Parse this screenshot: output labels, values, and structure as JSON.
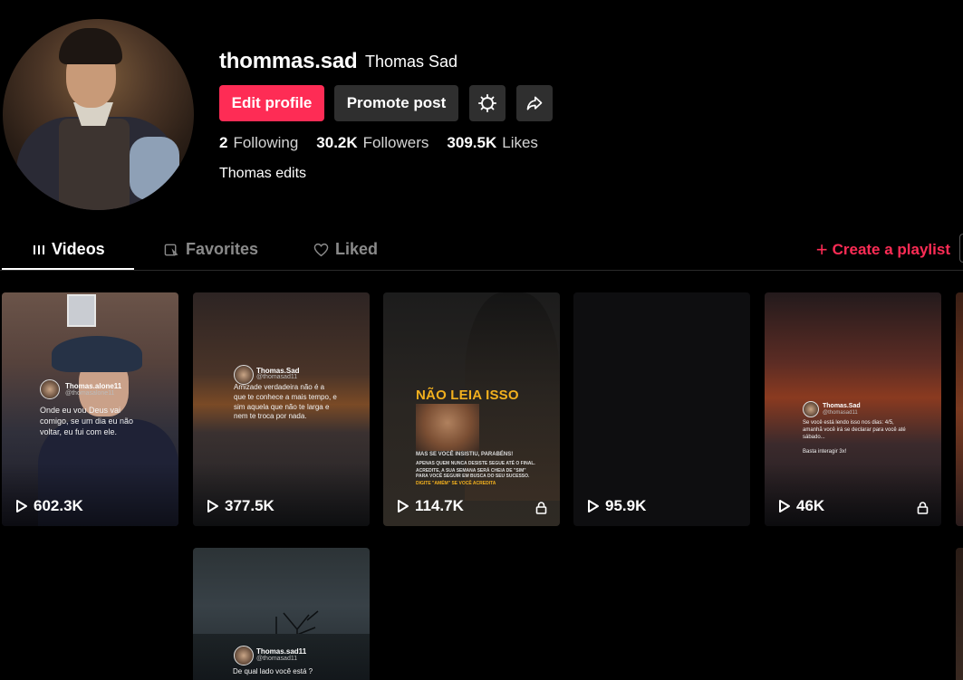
{
  "profile": {
    "username": "thommas.sad",
    "nickname": "Thomas Sad",
    "edit_label": "Edit profile",
    "promote_label": "Promote post",
    "bio": "Thomas edits",
    "stats": {
      "following_count": "2",
      "following_label": "Following",
      "followers_count": "30.2K",
      "followers_label": "Followers",
      "likes_count": "309.5K",
      "likes_label": "Likes"
    }
  },
  "tabs": {
    "videos": "Videos",
    "favorites": "Favorites",
    "liked": "Liked",
    "create_playlist": "Create a playlist"
  },
  "videos": [
    {
      "views": "602.3K",
      "overlay_name": "Thomas.alone11",
      "overlay_handle": "@thomasalone11",
      "overlay_text": "Onde eu vou Deus vai comigo, se um dia eu não voltar, eu fui com ele."
    },
    {
      "views": "377.5K",
      "overlay_name": "Thomas.Sad",
      "overlay_handle": "@thomasad11",
      "overlay_text": "Amizade verdadeira não é a que te conhece a mais tempo, e sim aquela que não te larga e nem te troca por nada."
    },
    {
      "views": "114.7K",
      "locked": true,
      "banner": "NÃO LEIA ISSO",
      "line1": "MAS SE VOCÊ INSISTIU, PARABÉNS!",
      "line2": "APENAS QUEM NUNCA DESISTE SEGUE ATÉ O FINAL.",
      "line3": "ACREDITE, A SUA SEMANA SERÁ CHEIA DE \"SIM\"",
      "line4": "PARA VOCÊ SEGUIR EM BUSCA DO SEU SUCESSO.",
      "line5": "DIGITE \"AMÉM\" SE VOCÊ ACREDITA"
    },
    {
      "views": "95.9K"
    },
    {
      "views": "46K",
      "locked": true,
      "overlay_name": "Thomas.Sad",
      "overlay_handle": "@thomasad11",
      "overlay_text": "Se você está lendo isso nos dias: 4/5, amanhã você irá se declarar para você até sábado...",
      "overlay_text2": "Basta interagir 3x!"
    },
    {
      "overlay_name": "Thomas.sad11",
      "overlay_handle": "@thomasad11",
      "overlay_text": "De qual lado você está ?"
    }
  ],
  "icons": {
    "settings": "gear-icon",
    "share": "share-arrow-icon",
    "play": "play-icon",
    "lock": "lock-icon",
    "videos_tab": "grid-bars-icon",
    "favorites_tab": "bookmark-icon",
    "liked_tab": "heart-icon",
    "plus": "plus-icon"
  },
  "colors": {
    "accent": "#fe2c55",
    "background": "#000000",
    "secondary_button": "#2f2f2f"
  }
}
